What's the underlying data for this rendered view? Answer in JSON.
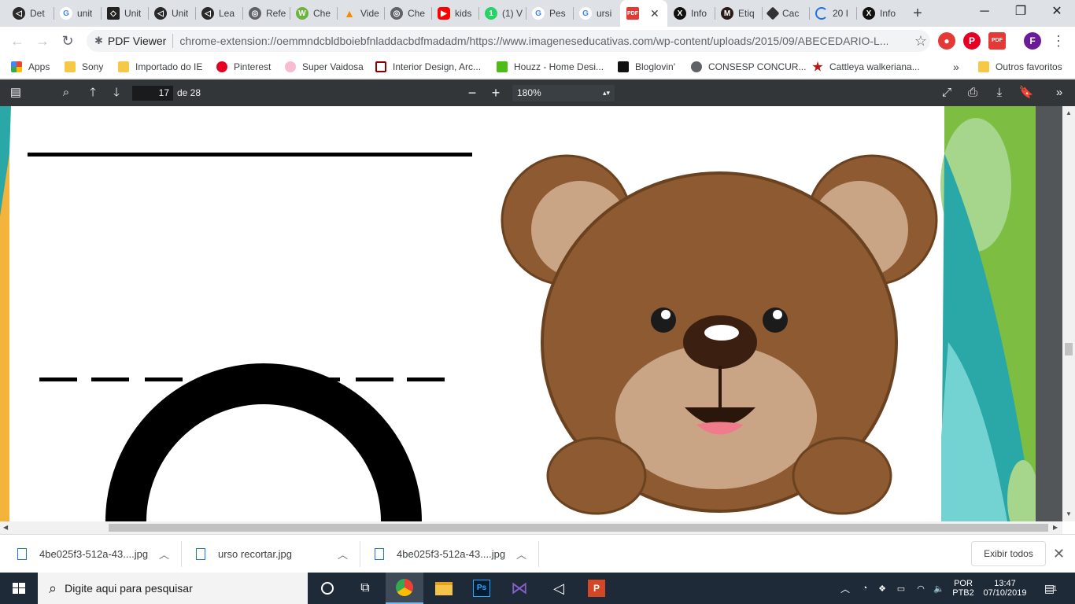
{
  "tabs": [
    {
      "label": "Det",
      "icon": "unity-icon"
    },
    {
      "label": "unit",
      "icon": "google-icon"
    },
    {
      "label": "Unit",
      "icon": "unity-icon"
    },
    {
      "label": "Unit",
      "icon": "unity-icon"
    },
    {
      "label": "Lea",
      "icon": "unity-icon"
    },
    {
      "label": "Refe",
      "icon": "globe-icon"
    },
    {
      "label": "Che",
      "icon": "wordpress-icon"
    },
    {
      "label": "Vide",
      "icon": "vlc-icon"
    },
    {
      "label": "Che",
      "icon": "globe-icon"
    },
    {
      "label": "kids",
      "icon": "youtube-icon"
    },
    {
      "label": "(1) V",
      "icon": "whatsapp-icon"
    },
    {
      "label": "Pes",
      "icon": "google-icon"
    },
    {
      "label": "ursi",
      "icon": "google-icon"
    },
    {
      "label": "",
      "icon": "pdf-icon",
      "active": true
    },
    {
      "label": "Info",
      "icon": "x-icon"
    },
    {
      "label": "Etiq",
      "icon": "etiq-icon"
    },
    {
      "label": "Cac",
      "icon": "diamond-icon"
    },
    {
      "label": "20 I",
      "icon": "loading-icon"
    },
    {
      "label": "Info",
      "icon": "x-icon"
    }
  ],
  "toolbar": {
    "site_name": "PDF Viewer",
    "url": "chrome-extension://oemmndcbldboiebfnladdacbdfmadadm/https://www.imageneseducativas.com/wp-content/uploads/2015/09/ABECEDARIO-L...",
    "profile_initial": "F"
  },
  "bookmarks": [
    {
      "label": "Apps",
      "icon": "apps-grid-icon"
    },
    {
      "label": "Sony",
      "icon": "folder-icon"
    },
    {
      "label": "Importado do IE",
      "icon": "folder-icon"
    },
    {
      "label": "Pinterest",
      "icon": "pinterest-icon"
    },
    {
      "label": "Super Vaidosa",
      "icon": "super-vaidosa-icon"
    },
    {
      "label": "Interior Design, Arc...",
      "icon": "interior-design-icon"
    },
    {
      "label": "Houzz - Home Desi...",
      "icon": "houzz-icon"
    },
    {
      "label": "Bloglovin'",
      "icon": "bloglovin-icon"
    },
    {
      "label": "CONSESP CONCUR...",
      "icon": "globe-icon"
    },
    {
      "label": "Cattleya walkeriana...",
      "icon": "cattleya-icon"
    }
  ],
  "bookmarks_more": "»",
  "other_bookmarks": "Outros favoritos",
  "pdf": {
    "page_number": "17",
    "page_of": "de 28",
    "zoom": "180%"
  },
  "downloads": [
    {
      "label": "4be025f3-512a-43....jpg"
    },
    {
      "label": "urso recortar.jpg"
    },
    {
      "label": "4be025f3-512a-43....jpg"
    }
  ],
  "downloads_show_all": "Exibir todos",
  "taskbar": {
    "search_placeholder": "Digite aqui para pesquisar",
    "lang_top": "POR",
    "lang_bottom": "PTB2",
    "time": "13:47",
    "date": "07/10/2019",
    "notification_count": "1"
  },
  "colors": {
    "pdf_toolbar": "#323639",
    "bear_fur": "#8d5a32",
    "bear_outline": "#6b421f",
    "bear_inner": "#c9a586",
    "taskbar": "#1e2a38"
  }
}
